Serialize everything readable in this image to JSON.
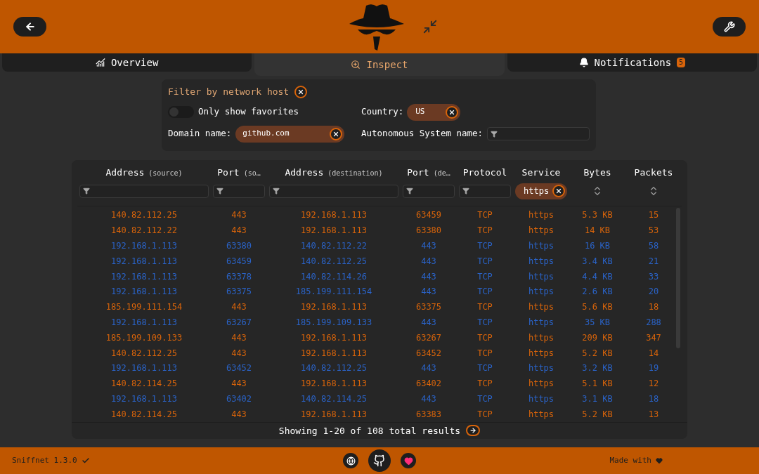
{
  "tabs": [
    {
      "label": "Overview",
      "selected": false
    },
    {
      "label": "Inspect",
      "selected": true
    },
    {
      "label": "Notifications",
      "selected": false,
      "badge": "5"
    }
  ],
  "host_filter": {
    "title": "Filter by network host",
    "favorites": {
      "label": "Only show favorites",
      "on": false
    },
    "country": {
      "label": "Country:",
      "value": "US"
    },
    "domain": {
      "label": "Domain name:",
      "value": "github.com"
    },
    "as_name": {
      "label": "Autonomous System name:"
    }
  },
  "table": {
    "columns": [
      {
        "label": "Address",
        "sub": "(source)",
        "kind": "text"
      },
      {
        "label": "Port",
        "sub": "(so…",
        "kind": "text"
      },
      {
        "label": "Address",
        "sub": "(destination)",
        "kind": "text"
      },
      {
        "label": "Port",
        "sub": "(de…",
        "kind": "text"
      },
      {
        "label": "Protocol",
        "kind": "text"
      },
      {
        "label": "Service",
        "kind": "pill",
        "value": "https"
      },
      {
        "label": "Bytes",
        "kind": "sort"
      },
      {
        "label": "Packets",
        "kind": "sort"
      }
    ],
    "rows": [
      {
        "kind": "incoming",
        "cells": [
          "140.82.112.25",
          "443",
          "192.168.1.113",
          "63459",
          "TCP",
          "https",
          "5.3 KB",
          "15"
        ]
      },
      {
        "kind": "incoming",
        "cells": [
          "140.82.112.22",
          "443",
          "192.168.1.113",
          "63380",
          "TCP",
          "https",
          "14 KB",
          "53"
        ]
      },
      {
        "kind": "outgoing",
        "cells": [
          "192.168.1.113",
          "63380",
          "140.82.112.22",
          "443",
          "TCP",
          "https",
          "16 KB",
          "58"
        ]
      },
      {
        "kind": "outgoing",
        "cells": [
          "192.168.1.113",
          "63459",
          "140.82.112.25",
          "443",
          "TCP",
          "https",
          "3.4 KB",
          "21"
        ]
      },
      {
        "kind": "outgoing",
        "cells": [
          "192.168.1.113",
          "63378",
          "140.82.114.26",
          "443",
          "TCP",
          "https",
          "4.4 KB",
          "33"
        ]
      },
      {
        "kind": "outgoing",
        "cells": [
          "192.168.1.113",
          "63375",
          "185.199.111.154",
          "443",
          "TCP",
          "https",
          "2.6 KB",
          "20"
        ]
      },
      {
        "kind": "incoming",
        "cells": [
          "185.199.111.154",
          "443",
          "192.168.1.113",
          "63375",
          "TCP",
          "https",
          "5.6 KB",
          "18"
        ]
      },
      {
        "kind": "outgoing",
        "cells": [
          "192.168.1.113",
          "63267",
          "185.199.109.133",
          "443",
          "TCP",
          "https",
          "35 KB",
          "288"
        ]
      },
      {
        "kind": "incoming",
        "cells": [
          "185.199.109.133",
          "443",
          "192.168.1.113",
          "63267",
          "TCP",
          "https",
          "209 KB",
          "347"
        ]
      },
      {
        "kind": "incoming",
        "cells": [
          "140.82.112.25",
          "443",
          "192.168.1.113",
          "63452",
          "TCP",
          "https",
          "5.2 KB",
          "14"
        ]
      },
      {
        "kind": "outgoing",
        "cells": [
          "192.168.1.113",
          "63452",
          "140.82.112.25",
          "443",
          "TCP",
          "https",
          "3.2 KB",
          "19"
        ]
      },
      {
        "kind": "incoming",
        "cells": [
          "140.82.114.25",
          "443",
          "192.168.1.113",
          "63402",
          "TCP",
          "https",
          "5.1 KB",
          "12"
        ]
      },
      {
        "kind": "outgoing",
        "cells": [
          "192.168.1.113",
          "63402",
          "140.82.114.25",
          "443",
          "TCP",
          "https",
          "3.1 KB",
          "18"
        ]
      },
      {
        "kind": "incoming",
        "cells": [
          "140.82.114.25",
          "443",
          "192.168.1.113",
          "63383",
          "TCP",
          "https",
          "5.2 KB",
          "13"
        ]
      }
    ],
    "results": "Showing 1-20 of 108 total results"
  },
  "footer": {
    "version": "Sniffnet 1.3.0",
    "made_with": "Made with"
  }
}
